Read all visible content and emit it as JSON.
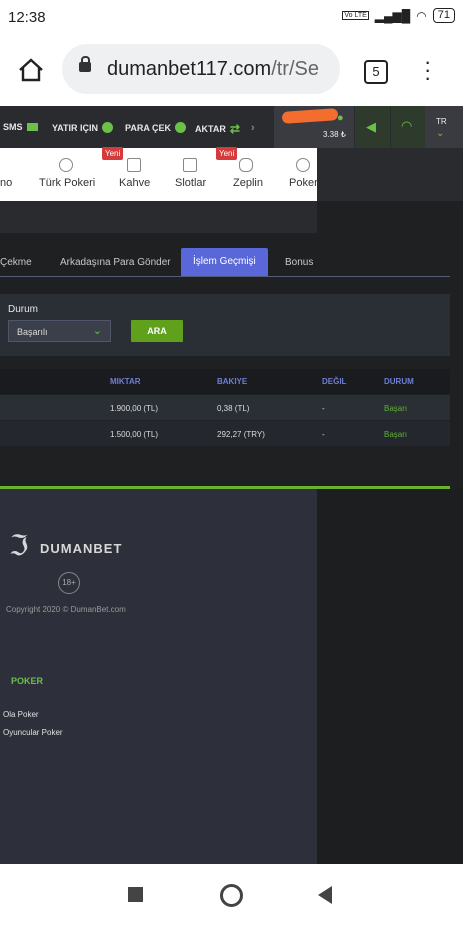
{
  "status_bar": {
    "time": "12:38",
    "network": "Vo LTE",
    "battery": "71"
  },
  "browser": {
    "url_domain": "dumanbet117.com",
    "url_path": "/tr/Se",
    "tab_count": "5"
  },
  "top_nav": {
    "items": [
      {
        "label": "SMS"
      },
      {
        "label": "YATIR IÇIN"
      },
      {
        "label": "PARA ÇEK"
      },
      {
        "label": "AKTAR"
      }
    ],
    "arrow": "›",
    "balance": "3.38 ₺",
    "language": "TR"
  },
  "games_menu": {
    "items": [
      {
        "label": "no",
        "badge": ""
      },
      {
        "label": "Türk Pokeri",
        "badge": ""
      },
      {
        "label": "Kahve",
        "badge": "Yeni"
      },
      {
        "label": "Slotlar",
        "badge": ""
      },
      {
        "label": "Zeplin",
        "badge": "Yeni"
      },
      {
        "label": "Poker",
        "badge": ""
      }
    ]
  },
  "tabs": [
    {
      "label": "Çekme"
    },
    {
      "label": "Arkadaşına Para Gönder"
    },
    {
      "label": "İşlem Geçmişi",
      "active": true
    },
    {
      "label": "Bonus"
    }
  ],
  "filter": {
    "label": "Durum",
    "selected": "Başarılı",
    "button": "ARA"
  },
  "table": {
    "columns": [
      "MIKTAR",
      "BAKIYE",
      "DEĞIL",
      "DURUM"
    ],
    "rows": [
      {
        "amount": "1.900,00 (TL)",
        "balance": "0,38 (TL)",
        "other": "-",
        "status": "Başarı"
      },
      {
        "amount": "1.500,00 (TL)",
        "balance": "292,27 (TRY)",
        "other": "-",
        "status": "Başarı"
      }
    ]
  },
  "footer": {
    "brand": "DUMANBET",
    "age": "18+",
    "copyright": "Copyright 2020 © DumanBet.com",
    "poker_title": "POKER",
    "poker_links": [
      "Ola Poker",
      "Oyuncular Poker"
    ]
  },
  "colors": {
    "accent_green": "#6cc04a",
    "tab_active": "#5a67d8",
    "header_blue": "#6d7fd6"
  }
}
